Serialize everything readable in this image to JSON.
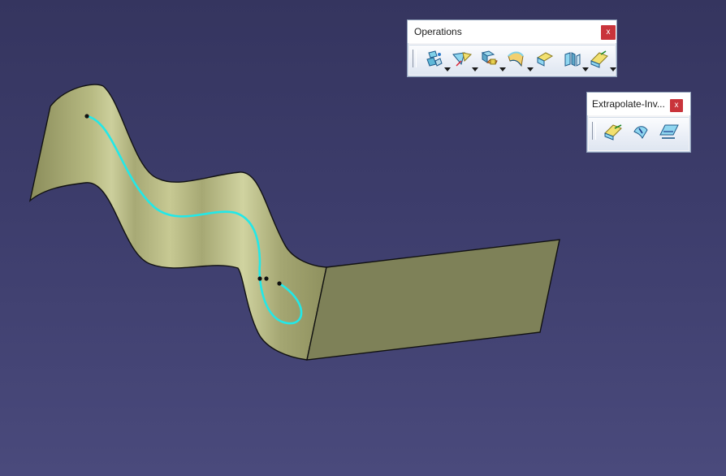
{
  "operations_toolbar": {
    "title": "Operations",
    "close_label": "x",
    "buttons": [
      {
        "icon": "join-icon",
        "has_dropdown": true
      },
      {
        "icon": "split-icon",
        "has_dropdown": true
      },
      {
        "icon": "boundary-icon",
        "has_dropdown": true
      },
      {
        "icon": "fillet-icon",
        "has_dropdown": true
      },
      {
        "icon": "translate-icon",
        "has_dropdown": false
      },
      {
        "icon": "extrapolate-icon",
        "has_dropdown": true
      },
      {
        "icon": "invert-orientation-icon",
        "has_dropdown": true
      }
    ]
  },
  "extrapolate_toolbar": {
    "title": "Extrapolate-Inv...",
    "close_label": "x",
    "buttons": [
      {
        "icon": "extrapolate-icon"
      },
      {
        "icon": "invert-icon"
      },
      {
        "icon": "near-icon"
      }
    ]
  },
  "colors": {
    "background_top": "#35355f",
    "background_bottom": "#4a4a7c",
    "surface": "#b8ba86",
    "flat_surface": "#7e8158",
    "curve": "#22e8e8",
    "edge": "#111111"
  }
}
